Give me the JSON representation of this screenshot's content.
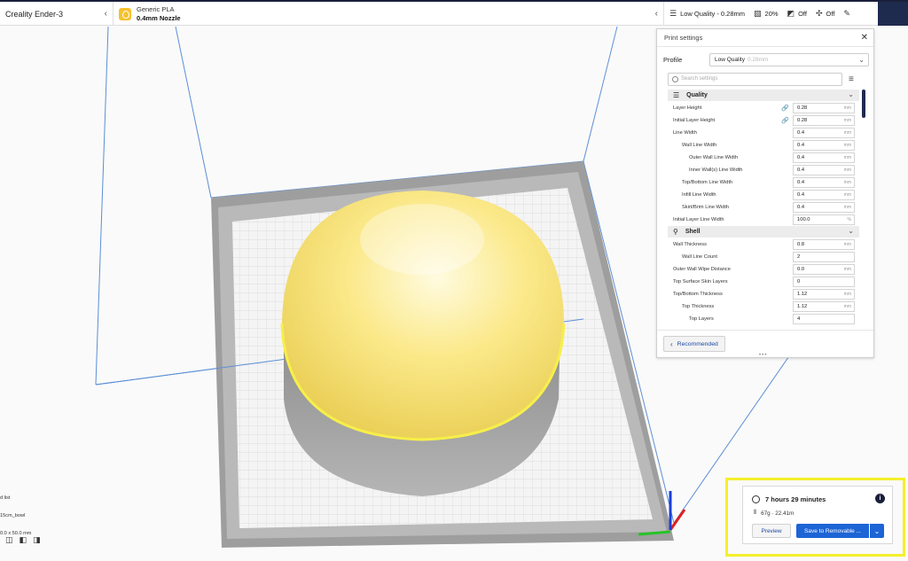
{
  "topbar": {
    "printer": "Creality Ender-3",
    "material_name": "Generic PLA",
    "nozzle": "0.4mm Nozzle",
    "quality": "Low Quality - 0.28mm",
    "infill": "20%",
    "support": "Off",
    "adhesion": "Off"
  },
  "panel": {
    "title": "Print settings",
    "profile_label": "Profile",
    "profile_value": "Low Quality",
    "profile_sub": "0.28mm",
    "search_placeholder": "Search settings",
    "recommended_label": "Recommended",
    "categories": [
      {
        "title": "Quality",
        "icon": "quality-icon",
        "rows": [
          {
            "label": "Layer Height",
            "value": "0.28",
            "unit": "mm",
            "level": 0,
            "linked": true
          },
          {
            "label": "Initial Layer Height",
            "value": "0.28",
            "unit": "mm",
            "level": 0,
            "linked": true
          },
          {
            "label": "Line Width",
            "value": "0.4",
            "unit": "mm",
            "level": 0,
            "linked": false
          },
          {
            "label": "Wall Line Width",
            "value": "0.4",
            "unit": "mm",
            "level": 1,
            "linked": false
          },
          {
            "label": "Outer Wall Line Width",
            "value": "0.4",
            "unit": "mm",
            "level": 2,
            "linked": false
          },
          {
            "label": "Inner Wall(s) Line Width",
            "value": "0.4",
            "unit": "mm",
            "level": 2,
            "linked": false
          },
          {
            "label": "Top/Bottom Line Width",
            "value": "0.4",
            "unit": "mm",
            "level": 1,
            "linked": false
          },
          {
            "label": "Infill Line Width",
            "value": "0.4",
            "unit": "mm",
            "level": 1,
            "linked": false
          },
          {
            "label": "Skirt/Brim Line Width",
            "value": "0.4",
            "unit": "mm",
            "level": 1,
            "linked": false
          },
          {
            "label": "Initial Layer Line Width",
            "value": "100.0",
            "unit": "%",
            "level": 0,
            "linked": false
          }
        ]
      },
      {
        "title": "Shell",
        "icon": "shell-icon",
        "rows": [
          {
            "label": "Wall Thickness",
            "value": "0.8",
            "unit": "mm",
            "level": 0,
            "linked": false
          },
          {
            "label": "Wall Line Count",
            "value": "2",
            "unit": "",
            "level": 1,
            "linked": false
          },
          {
            "label": "Outer Wall Wipe Distance",
            "value": "0.0",
            "unit": "mm",
            "level": 0,
            "linked": false
          },
          {
            "label": "Top Surface Skin Layers",
            "value": "0",
            "unit": "",
            "level": 0,
            "linked": false
          },
          {
            "label": "Top/Bottom Thickness",
            "value": "1.12",
            "unit": "mm",
            "level": 0,
            "linked": false
          },
          {
            "label": "Top Thickness",
            "value": "1.12",
            "unit": "mm",
            "level": 1,
            "linked": false
          },
          {
            "label": "Top Layers",
            "value": "4",
            "unit": "",
            "level": 2,
            "linked": false
          }
        ]
      }
    ]
  },
  "object_info": {
    "line1": "d list",
    "line2": "15cm_bowl",
    "line3": "0.0 x 50.0 mm"
  },
  "estimate": {
    "time": "7 hours 29 minutes",
    "material": "67g · 22.41m",
    "preview_label": "Preview",
    "save_label": "Save to Removable ..."
  },
  "colors": {
    "accent": "#1d64d6",
    "highlight": "#f5ef2d",
    "model": "#f7e46a",
    "topbar_dark": "#1a1f3a"
  }
}
